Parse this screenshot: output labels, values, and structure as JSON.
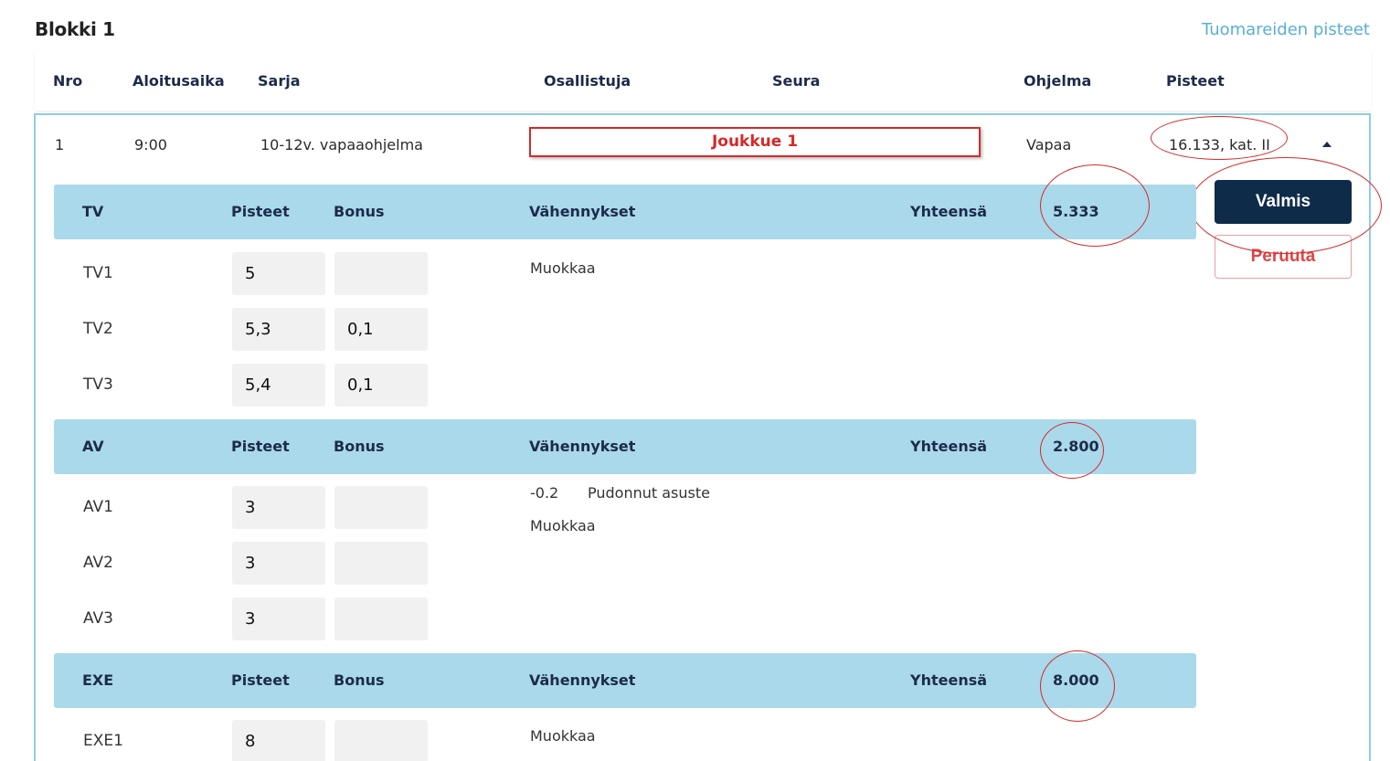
{
  "block": {
    "title": "Blokki 1",
    "judges_link": "Tuomareiden pisteet"
  },
  "columns": {
    "nro": "Nro",
    "start": "Aloitusaika",
    "series": "Sarja",
    "participant": "Osallistuja",
    "club": "Seura",
    "program": "Ohjelma",
    "points": "Pisteet"
  },
  "entry": {
    "nro": "1",
    "start": "9:00",
    "series": "10-12v. vapaaohjelma",
    "participant": "Joukkue 1",
    "program": "Vapaa",
    "points": "16.133, kat. II"
  },
  "buttons": {
    "ready": "Valmis",
    "cancel": "Peruuta"
  },
  "section_labels": {
    "points": "Pisteet",
    "bonus": "Bonus",
    "deductions": "Vähennykset",
    "total": "Yhteensä"
  },
  "edit_label": "Muokkaa",
  "sections": [
    {
      "name": "TV",
      "total": "5.333",
      "judges": [
        {
          "label": "TV1",
          "points": "5",
          "bonus": ""
        },
        {
          "label": "TV2",
          "points": "5,3",
          "bonus": "0,1"
        },
        {
          "label": "TV3",
          "points": "5,4",
          "bonus": "0,1"
        }
      ]
    },
    {
      "name": "AV",
      "total": "2.800",
      "deduction": {
        "value": "-0.2",
        "reason": "Pudonnut asuste"
      },
      "judges": [
        {
          "label": "AV1",
          "points": "3",
          "bonus": ""
        },
        {
          "label": "AV2",
          "points": "3",
          "bonus": ""
        },
        {
          "label": "AV3",
          "points": "3",
          "bonus": ""
        }
      ]
    },
    {
      "name": "EXE",
      "total": "8.000",
      "judges": [
        {
          "label": "EXE1",
          "points": "8",
          "bonus": ""
        }
      ]
    }
  ],
  "annotation_color": "#d42a2a"
}
